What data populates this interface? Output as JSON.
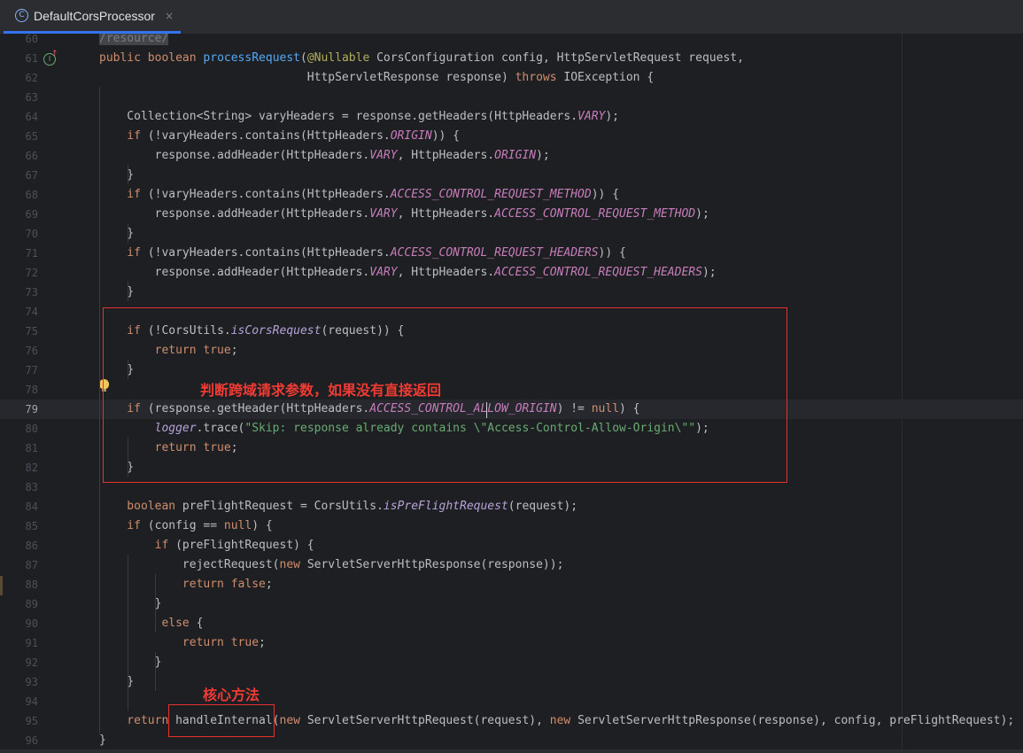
{
  "tab": {
    "icon": "class-icon",
    "icon_glyph": "C",
    "title": "DefaultCorsProcessor",
    "close_glyph": "×"
  },
  "gutter": {
    "override_glyph": "I"
  },
  "annotations": {
    "note_cors_check": "判断跨域请求参数，如果没有直接返回",
    "note_core_method": "核心方法"
  },
  "lines": [
    {
      "n": "60"
    },
    {
      "n": "61"
    },
    {
      "n": "62"
    },
    {
      "n": "63"
    },
    {
      "n": "64"
    },
    {
      "n": "65"
    },
    {
      "n": "66"
    },
    {
      "n": "67"
    },
    {
      "n": "68"
    },
    {
      "n": "69"
    },
    {
      "n": "70"
    },
    {
      "n": "71"
    },
    {
      "n": "72"
    },
    {
      "n": "73"
    },
    {
      "n": "74"
    },
    {
      "n": "75"
    },
    {
      "n": "76"
    },
    {
      "n": "77"
    },
    {
      "n": "78"
    },
    {
      "n": "79"
    },
    {
      "n": "80"
    },
    {
      "n": "81"
    },
    {
      "n": "82"
    },
    {
      "n": "83"
    },
    {
      "n": "84"
    },
    {
      "n": "85"
    },
    {
      "n": "86"
    },
    {
      "n": "87"
    },
    {
      "n": "88"
    },
    {
      "n": "89"
    },
    {
      "n": "90"
    },
    {
      "n": "91"
    },
    {
      "n": "92"
    },
    {
      "n": "93"
    },
    {
      "n": "94"
    },
    {
      "n": "95"
    },
    {
      "n": "96"
    }
  ],
  "code": {
    "l60": "/resource/",
    "l61": [
      [
        "kw",
        "public "
      ],
      [
        "kw",
        "boolean "
      ],
      [
        "fn",
        "processRequest"
      ],
      [
        "par",
        "("
      ],
      [
        "ann",
        "@Nullable "
      ],
      [
        "",
        "CorsConfiguration config, HttpServletRequest request,"
      ]
    ],
    "l62": [
      [
        "",
        "                              HttpServletResponse response"
      ],
      [
        "par",
        ") "
      ],
      [
        "kw",
        "throws "
      ],
      [
        "",
        "IOException "
      ],
      [
        "par",
        "{"
      ]
    ],
    "l64": [
      [
        "",
        "    Collection<String> varyHeaders = response.getHeaders(HttpHeaders."
      ],
      [
        "const",
        "VARY"
      ],
      [
        "",
        ");"
      ]
    ],
    "l65": [
      [
        "kw",
        "    if "
      ],
      [
        "",
        "(!varyHeaders.contains(HttpHeaders."
      ],
      [
        "const",
        "ORIGIN"
      ],
      [
        "",
        ")) {"
      ]
    ],
    "l66": [
      [
        "",
        "        response.addHeader(HttpHeaders."
      ],
      [
        "const",
        "VARY"
      ],
      [
        "",
        ", HttpHeaders."
      ],
      [
        "const",
        "ORIGIN"
      ],
      [
        "",
        ");"
      ]
    ],
    "l67": [
      [
        "",
        "    }"
      ]
    ],
    "l68": [
      [
        "kw",
        "    if "
      ],
      [
        "",
        "(!varyHeaders.contains(HttpHeaders."
      ],
      [
        "const",
        "ACCESS_CONTROL_REQUEST_METHOD"
      ],
      [
        "",
        ")) {"
      ]
    ],
    "l69": [
      [
        "",
        "        response.addHeader(HttpHeaders."
      ],
      [
        "const",
        "VARY"
      ],
      [
        "",
        ", HttpHeaders."
      ],
      [
        "const",
        "ACCESS_CONTROL_REQUEST_METHOD"
      ],
      [
        "",
        ");"
      ]
    ],
    "l70": [
      [
        "",
        "    }"
      ]
    ],
    "l71": [
      [
        "kw",
        "    if "
      ],
      [
        "",
        "(!varyHeaders.contains(HttpHeaders."
      ],
      [
        "const",
        "ACCESS_CONTROL_REQUEST_HEADERS"
      ],
      [
        "",
        ")) {"
      ]
    ],
    "l72": [
      [
        "",
        "        response.addHeader(HttpHeaders."
      ],
      [
        "const",
        "VARY"
      ],
      [
        "",
        ", HttpHeaders."
      ],
      [
        "const",
        "ACCESS_CONTROL_REQUEST_HEADERS"
      ],
      [
        "",
        ");"
      ]
    ],
    "l73": [
      [
        "",
        "    }"
      ]
    ],
    "l75": [
      [
        "kw",
        "    if "
      ],
      [
        "",
        "(!CorsUtils."
      ],
      [
        "st",
        "isCorsRequest"
      ],
      [
        "",
        "(request)) {"
      ]
    ],
    "l76": [
      [
        "kw",
        "        return "
      ],
      [
        "kw",
        "true"
      ],
      [
        "",
        ";"
      ]
    ],
    "l77": [
      [
        "",
        "    }"
      ]
    ],
    "l79": [
      [
        "kw",
        "    if "
      ],
      [
        "",
        "(response.getHeader(HttpHeaders."
      ],
      [
        "const",
        "ACCESS_CONTROL_ALLOW_ORIGIN"
      ],
      [
        "",
        ") != "
      ],
      [
        "kw",
        "null"
      ],
      [
        "",
        ") {"
      ]
    ],
    "l80": [
      [
        "st",
        "        logger"
      ],
      [
        "",
        ".trace("
      ],
      [
        "str",
        "\"Skip: response already contains \\\"Access-Control-Allow-Origin\\\"\""
      ],
      [
        "",
        ");"
      ]
    ],
    "l81": [
      [
        "kw",
        "        return "
      ],
      [
        "kw",
        "true"
      ],
      [
        "",
        ";"
      ]
    ],
    "l82": [
      [
        "",
        "    }"
      ]
    ],
    "l84": [
      [
        "kw",
        "    boolean "
      ],
      [
        "",
        "preFlightRequest = CorsUtils."
      ],
      [
        "st",
        "isPreFlightRequest"
      ],
      [
        "",
        "(request);"
      ]
    ],
    "l85": [
      [
        "kw",
        "    if "
      ],
      [
        "",
        "(config == "
      ],
      [
        "kw",
        "null"
      ],
      [
        "",
        ") {"
      ]
    ],
    "l86": [
      [
        "kw",
        "        if "
      ],
      [
        "",
        "(preFlightRequest) {"
      ]
    ],
    "l87": [
      [
        "",
        "            rejectRequest("
      ],
      [
        "kw",
        "new "
      ],
      [
        "",
        "ServletServerHttpResponse(response));"
      ]
    ],
    "l88": [
      [
        "kw",
        "            return "
      ],
      [
        "kw",
        "false"
      ],
      [
        "",
        ";"
      ]
    ],
    "l89": [
      [
        "",
        "        }"
      ]
    ],
    "l90": [
      [
        "kw",
        "         else "
      ],
      [
        "",
        "{"
      ]
    ],
    "l91": [
      [
        "kw",
        "            return "
      ],
      [
        "kw",
        "true"
      ],
      [
        "",
        ";"
      ]
    ],
    "l92": [
      [
        "",
        "        }"
      ]
    ],
    "l93": [
      [
        "",
        "    }"
      ]
    ],
    "l95": [
      [
        "kw",
        "    return "
      ],
      [
        "",
        "handleInternal("
      ],
      [
        "kw",
        "new "
      ],
      [
        "",
        "ServletServerHttpRequest(request), "
      ],
      [
        "kw",
        "new "
      ],
      [
        "",
        "ServletServerHttpResponse(response), config, preFlightRequest);"
      ]
    ],
    "l96": [
      [
        "",
        "}"
      ]
    ]
  }
}
